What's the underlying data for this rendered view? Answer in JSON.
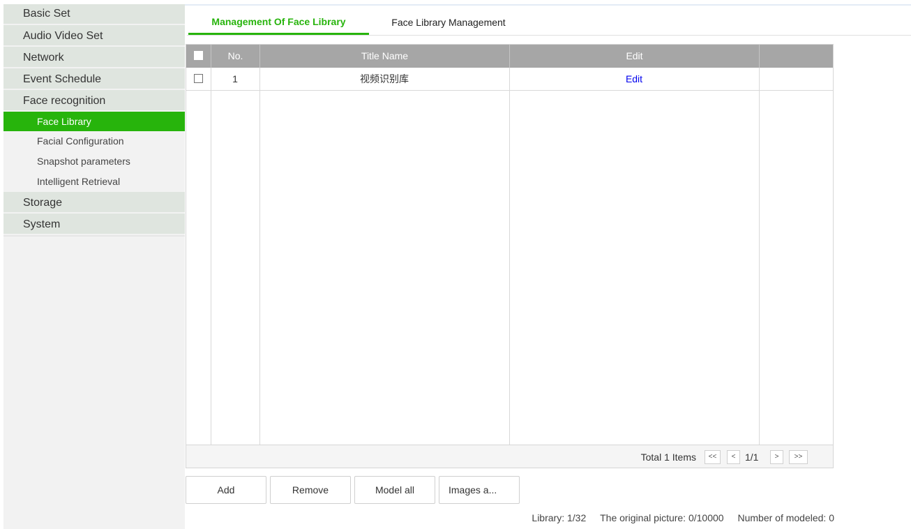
{
  "sidebar": {
    "sections": [
      {
        "label": "Basic Set"
      },
      {
        "label": "Audio Video Set"
      },
      {
        "label": "Network"
      },
      {
        "label": "Event Schedule"
      },
      {
        "label": "Face recognition"
      },
      {
        "label": "Storage"
      },
      {
        "label": "System"
      }
    ],
    "face_sub_items": [
      {
        "label": "Face Library",
        "active": true
      },
      {
        "label": "Facial Configuration"
      },
      {
        "label": "Snapshot parameters"
      },
      {
        "label": "Intelligent Retrieval"
      }
    ]
  },
  "tabs": [
    {
      "label": "Management Of Face Library",
      "active": true
    },
    {
      "label": "Face Library Management"
    }
  ],
  "table": {
    "headers": {
      "no": "No.",
      "title": "Title Name",
      "edit": "Edit"
    },
    "rows": [
      {
        "no": "1",
        "title": "视频识别库",
        "edit": "Edit"
      }
    ]
  },
  "pagination": {
    "total": "Total 1 Items",
    "first": "<<",
    "prev": "<",
    "page": "1/1",
    "next": ">",
    "last": ">>"
  },
  "buttons": {
    "add": "Add",
    "remove": "Remove",
    "model_all": "Model all",
    "images": "Images a..."
  },
  "status": {
    "library": "Library: 1/32",
    "original_picture": "The original picture: 0/10000",
    "modeled": "Number of modeled: 0"
  },
  "colors": {
    "accent": "#27b40c",
    "link": "#0000ee",
    "header_bg": "#a6a6a6"
  }
}
